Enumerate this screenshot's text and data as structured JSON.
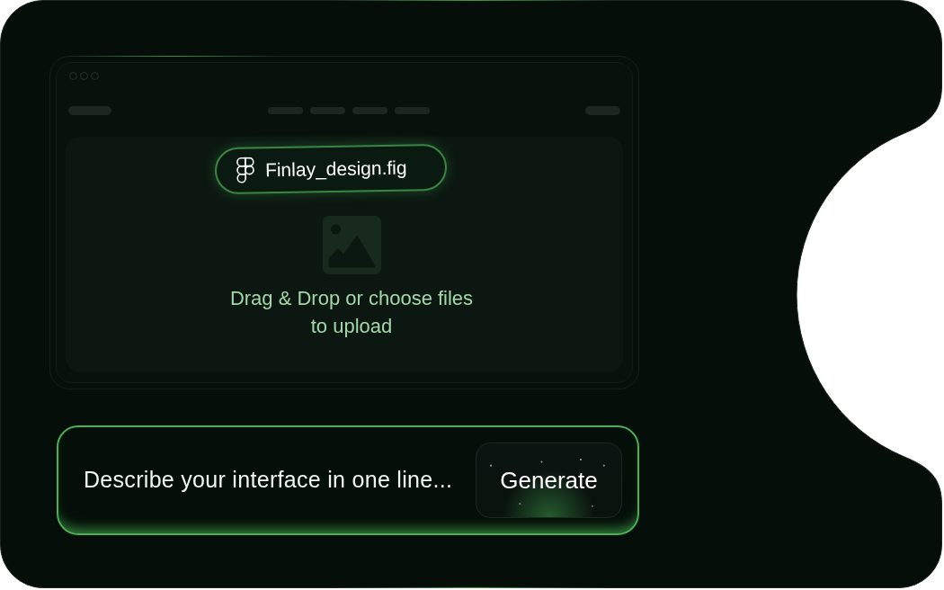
{
  "file_chip": {
    "filename": "Finlay_design.fig"
  },
  "upload": {
    "instruction": "Drag & Drop or choose files to upload"
  },
  "prompt": {
    "placeholder": "Describe your interface in one line...",
    "button": "Generate"
  }
}
